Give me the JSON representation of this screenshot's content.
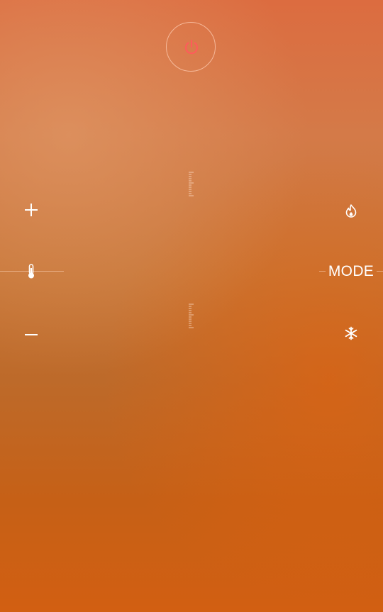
{
  "controls": {
    "power": {
      "icon": "power-icon",
      "color": "#ff5b5b"
    },
    "increase": {
      "icon": "plus-icon"
    },
    "temperature": {
      "icon": "thermometer-icon"
    },
    "decrease": {
      "icon": "minus-icon"
    },
    "heat": {
      "icon": "flame-icon"
    },
    "mode": {
      "label": "MODE"
    },
    "cool": {
      "icon": "snowflake-icon"
    }
  },
  "colors": {
    "background_top": "#dc6c40",
    "background_bottom": "#d25f12",
    "line": "#ffd7be"
  }
}
